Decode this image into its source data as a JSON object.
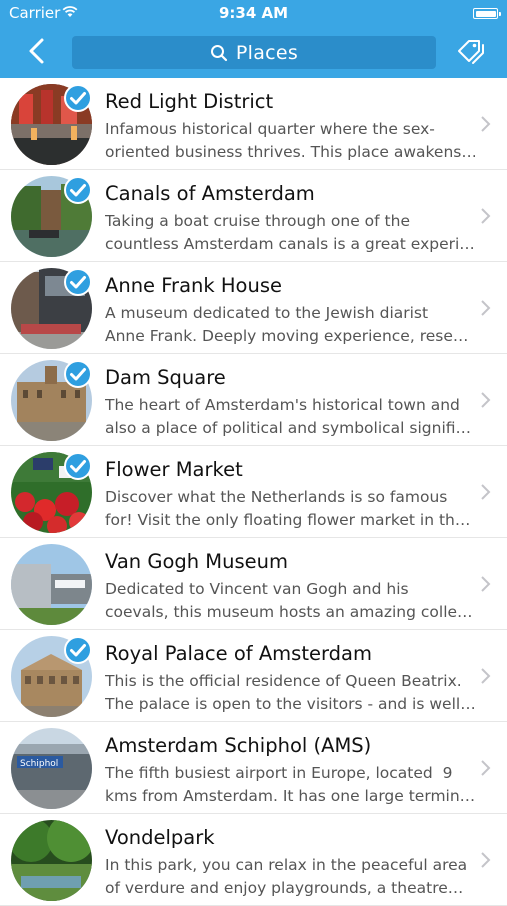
{
  "status_bar": {
    "carrier": "Carrier",
    "time": "9:34 AM"
  },
  "nav": {
    "search_label": "Places"
  },
  "colors": {
    "header": "#3aa6e4",
    "search_field": "#2b8dca",
    "check": "#2f9fe0"
  },
  "places": [
    {
      "title": "Red Light District",
      "line1": "Infamous historical quarter where the sex-",
      "line2": "oriented business thrives. This place awakens…",
      "checked": true
    },
    {
      "title": "Canals of Amsterdam",
      "line1": "Taking a boat cruise through one of the",
      "line2": "countless Amsterdam canals is a great experi…",
      "checked": true
    },
    {
      "title": "Anne Frank House",
      "line1": "A museum dedicated to the Jewish diarist",
      "line2": "Anne Frank. Deeply moving experience, rese…",
      "checked": true
    },
    {
      "title": "Dam Square",
      "line1": "The heart of Amsterdam's historical town and",
      "line2": "also a place of political and symbolical signifi…",
      "checked": true
    },
    {
      "title": "Flower Market",
      "line1": "Discover what the Netherlands is so famous",
      "line2": "for! Visit the only floating flower market in th…",
      "checked": true
    },
    {
      "title": "Van Gogh Museum",
      "line1": "Dedicated to Vincent van Gogh and his",
      "line2": "coevals, this museum hosts an amazing colle…",
      "checked": false
    },
    {
      "title": "Royal Palace of Amsterdam",
      "line1": "This is the official residence of Queen Beatrix.",
      "line2": "The palace is open to the visitors - and is well…",
      "checked": true
    },
    {
      "title": "Amsterdam Schiphol (AMS)",
      "line1": "The fifth busiest airport in Europe, located  9",
      "line2": "kms from Amsterdam. It has one large termin…",
      "checked": false,
      "sign_text": "Schiphol"
    },
    {
      "title": "Vondelpark",
      "line1": "In this park, you can relax in the peaceful area",
      "line2": "of verdure and enjoy playgrounds, a theatre…",
      "checked": false
    }
  ]
}
